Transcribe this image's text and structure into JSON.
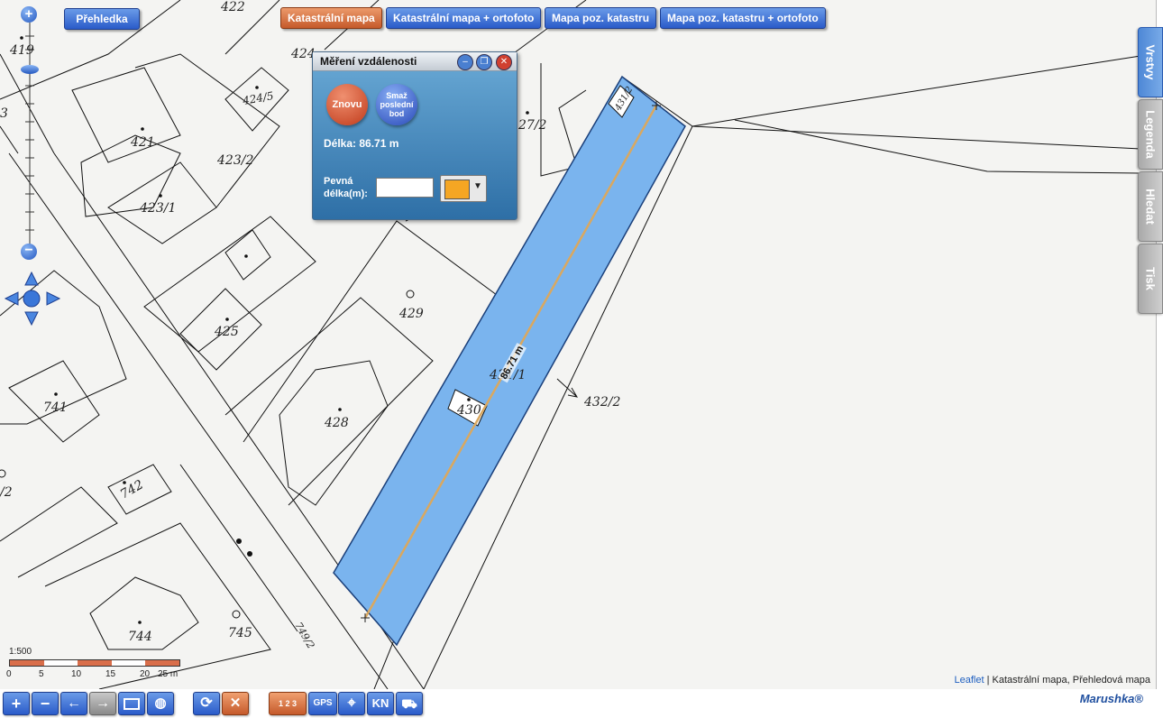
{
  "layer_buttons": {
    "overview": "Přehledka",
    "cadastral_map": "Katastrální mapa",
    "cadastral_ortho": "Katastrální mapa + ortofoto",
    "land_map": "Mapa poz. katastru",
    "land_map_ortho": "Mapa poz. katastru + ortofoto"
  },
  "side_tabs": {
    "layers": "Vrstvy",
    "legend": "Legenda",
    "search": "Hledat",
    "print": "Tisk"
  },
  "measure_dialog": {
    "title": "Měření vzdálenosti",
    "again_button": "Znovu",
    "delete_last_button": "Smaž poslední bod",
    "distance_text": "Délka: 86.71 m",
    "fixed_length_label_line1": "Pevná",
    "fixed_length_label_line2": "délka(m):",
    "fixed_length_value": "",
    "line_color": "#f5a623"
  },
  "measurement": {
    "line_label": "86.71 m",
    "line_color": "#d9a860",
    "fill_color": "#7ab4ee"
  },
  "parcels": {
    "p422": "422",
    "p424": "424",
    "p419": "419",
    "p424_5": "424/5",
    "p421": "421",
    "p423_2": "423/2",
    "p423_1": "423/1",
    "p27_2": "27/2",
    "p431_2": "431/2",
    "p429": "429",
    "p425": "425",
    "p431_1": "431/1",
    "p432_2": "432/2",
    "p741": "741",
    "p430": "430",
    "p428": "428",
    "p742": "742",
    "p2": "/2",
    "p3": "3",
    "p744": "744",
    "p745": "745",
    "p749_2": "749/2"
  },
  "scale_bar": {
    "ratio": "1:500",
    "ticks": [
      "0",
      "5",
      "10",
      "15",
      "20",
      "25 m"
    ]
  },
  "attribution": {
    "link": "Leaflet",
    "text": " | Katastrální mapa, Přehledová mapa"
  },
  "toolbar": {
    "gps": "GPS",
    "kn": "KN",
    "numbers": "1 2 3"
  },
  "brand": "Marushka®"
}
